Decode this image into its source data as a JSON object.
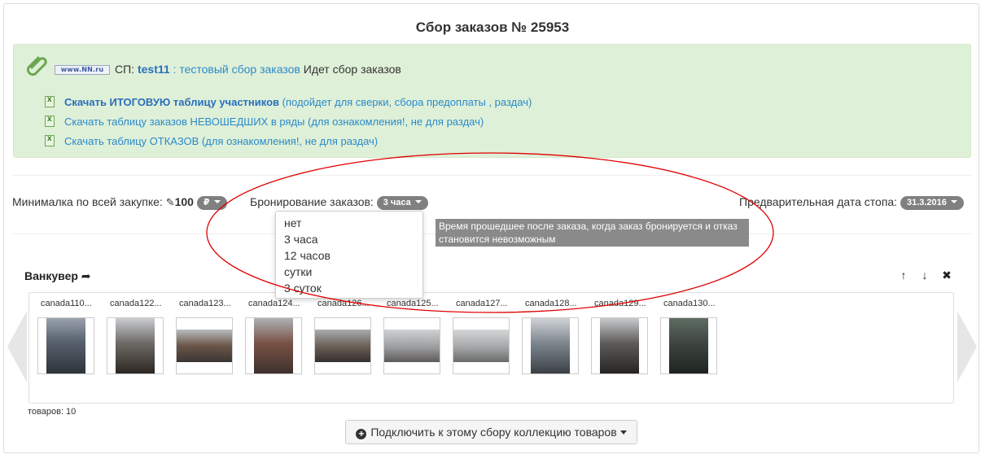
{
  "page_title": "Сбор заказов № 25953",
  "info": {
    "logo_text": "www.NN.ru",
    "sp_prefix": "СП:",
    "user": "test11",
    "separator": ":",
    "collection_link": "тестовый сбор заказов",
    "status": "Идет сбор заказов",
    "downloads": [
      {
        "bold_part": "Скачать ИТОГОВУЮ таблицу участников",
        "rest": " (подойдет для сверки, сбора предоплаты , раздач)"
      },
      {
        "bold_part": "",
        "rest": "Скачать таблицу заказов НЕВОШЕДШИХ в ряды (для ознакомления!, не для раздач)"
      },
      {
        "bold_part": "",
        "rest": "Скачать таблицу ОТКАЗОВ (для ознакомления!, не для раздач)"
      }
    ]
  },
  "options": {
    "min_label": "Минималка по всей закупке:",
    "min_value": "100",
    "min_currency": "₽",
    "booking_label": "Бронирование заказов:",
    "booking_value": "3 часа",
    "stop_label": "Предварительная дата стопа:",
    "stop_value": "31.3.2016"
  },
  "booking_dropdown": {
    "items": [
      "нет",
      "3 часа",
      "12 часов",
      "сутки",
      "3 суток"
    ]
  },
  "tooltip": "Время прошедшее после заказа, когда заказ бронируется и отказ становится невозможным",
  "collection": {
    "title": "Ванкувер",
    "controls": {
      "up": "↑",
      "down": "↓",
      "remove": "✖"
    },
    "items": [
      {
        "name": "canada110..."
      },
      {
        "name": "canada122..."
      },
      {
        "name": "canada123..."
      },
      {
        "name": "canada124..."
      },
      {
        "name": "canada126..."
      },
      {
        "name": "canada125..."
      },
      {
        "name": "canada127..."
      },
      {
        "name": "canada128..."
      },
      {
        "name": "canada129..."
      },
      {
        "name": "canada130..."
      }
    ],
    "count_label": "товаров: 10"
  },
  "connect_button": "Подключить к этому сбору коллекцию товаров",
  "colors": {
    "info_bg": "#dff0d8",
    "link": "#2a8acb",
    "pill": "#808080",
    "annotation": "#e00000"
  }
}
